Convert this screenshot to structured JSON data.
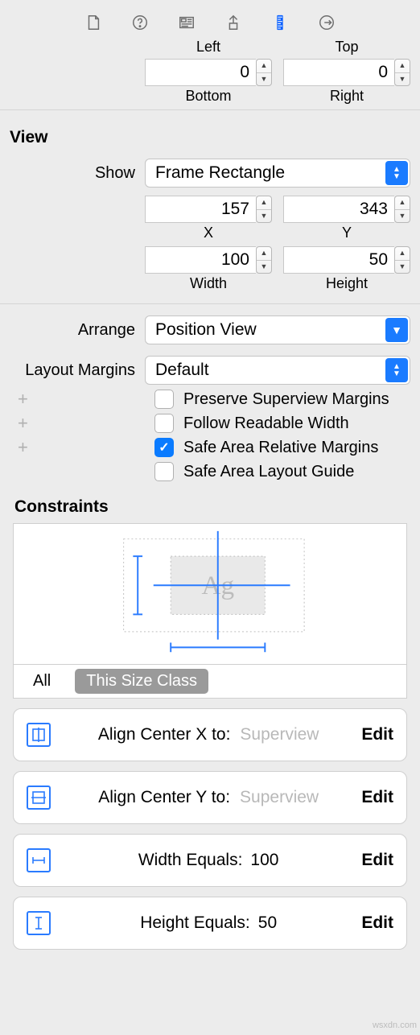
{
  "top_fields": {
    "left_label": "Left",
    "top_label": "Top",
    "bottom_value": "0",
    "bottom_label": "Bottom",
    "right_value": "0",
    "right_label": "Right"
  },
  "view": {
    "section_title": "View",
    "show_label": "Show",
    "show_value": "Frame Rectangle",
    "x_value": "157",
    "x_label": "X",
    "y_value": "343",
    "y_label": "Y",
    "width_value": "100",
    "width_label": "Width",
    "height_value": "50",
    "height_label": "Height",
    "arrange_label": "Arrange",
    "arrange_value": "Position View",
    "layout_margins_label": "Layout Margins",
    "layout_margins_value": "Default",
    "cb1": "Preserve Superview Margins",
    "cb2": "Follow Readable Width",
    "cb3": "Safe Area Relative Margins",
    "cb4": "Safe Area Layout Guide"
  },
  "constraints": {
    "title": "Constraints",
    "placeholder": "Ag",
    "tab_all": "All",
    "tab_this": "This Size Class",
    "rows": [
      {
        "label": "Align Center X to:",
        "value": "Superview",
        "edit": "Edit"
      },
      {
        "label": "Align Center Y to:",
        "value": "Superview",
        "edit": "Edit"
      },
      {
        "label": "Width Equals:",
        "value": "100",
        "edit": "Edit"
      },
      {
        "label": "Height Equals:",
        "value": "50",
        "edit": "Edit"
      }
    ]
  },
  "watermark": "wsxdn.com"
}
